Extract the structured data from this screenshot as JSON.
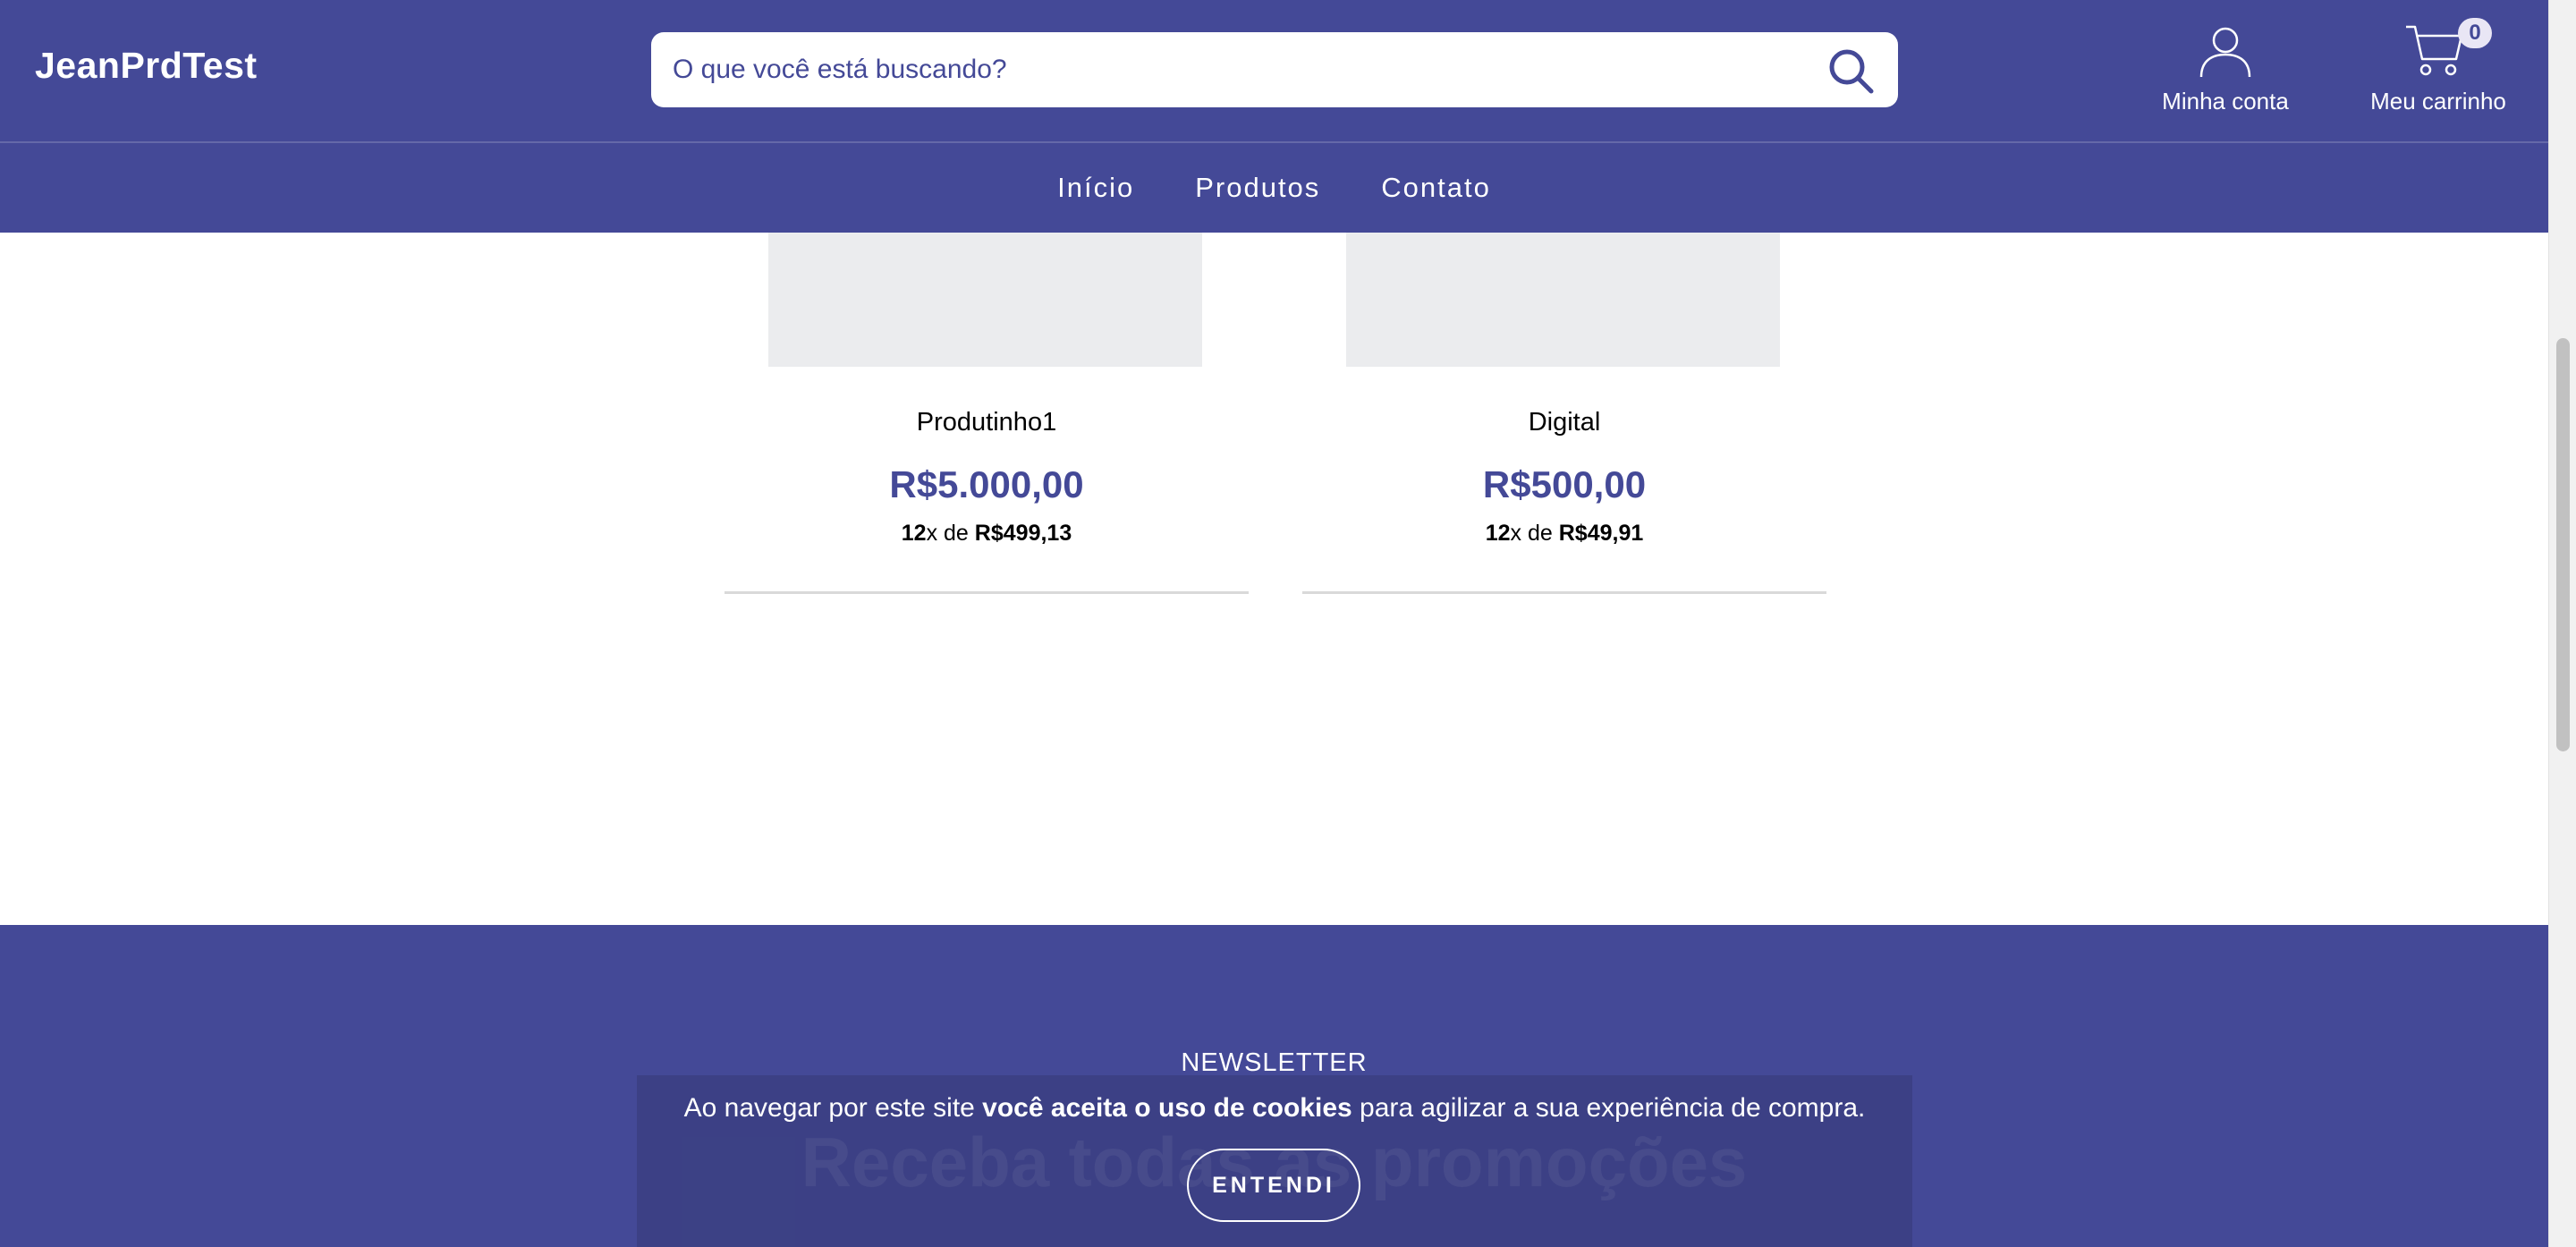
{
  "header": {
    "brand": "JeanPrdTest",
    "search": {
      "placeholder": "O que você está buscando?"
    },
    "account_label": "Minha conta",
    "cart_label": "Meu carrinho",
    "cart_count": "0"
  },
  "nav": {
    "items": [
      {
        "label": "Início"
      },
      {
        "label": "Produtos"
      },
      {
        "label": "Contato"
      }
    ]
  },
  "products": [
    {
      "name": "Produtinho1",
      "price": "R$5.000,00",
      "installments_count": "12",
      "installments_sep": "x de",
      "installment_value": "R$499,13"
    },
    {
      "name": "Digital",
      "price": "R$500,00",
      "installments_count": "12",
      "installments_sep": "x de",
      "installment_value": "R$49,91"
    }
  ],
  "newsletter": {
    "kicker": "NEWSLETTER",
    "title": "Receba todas as promoções"
  },
  "cookie": {
    "text_before": "Ao navegar por este site ",
    "text_bold": "você aceita o uso de cookies",
    "text_after": " para agilizar a sua experiência de compra.",
    "button_label": "ENTENDI"
  },
  "colors": {
    "brand": "#444997",
    "placeholder": "#ebecee",
    "badge": "#e9e6f5"
  }
}
